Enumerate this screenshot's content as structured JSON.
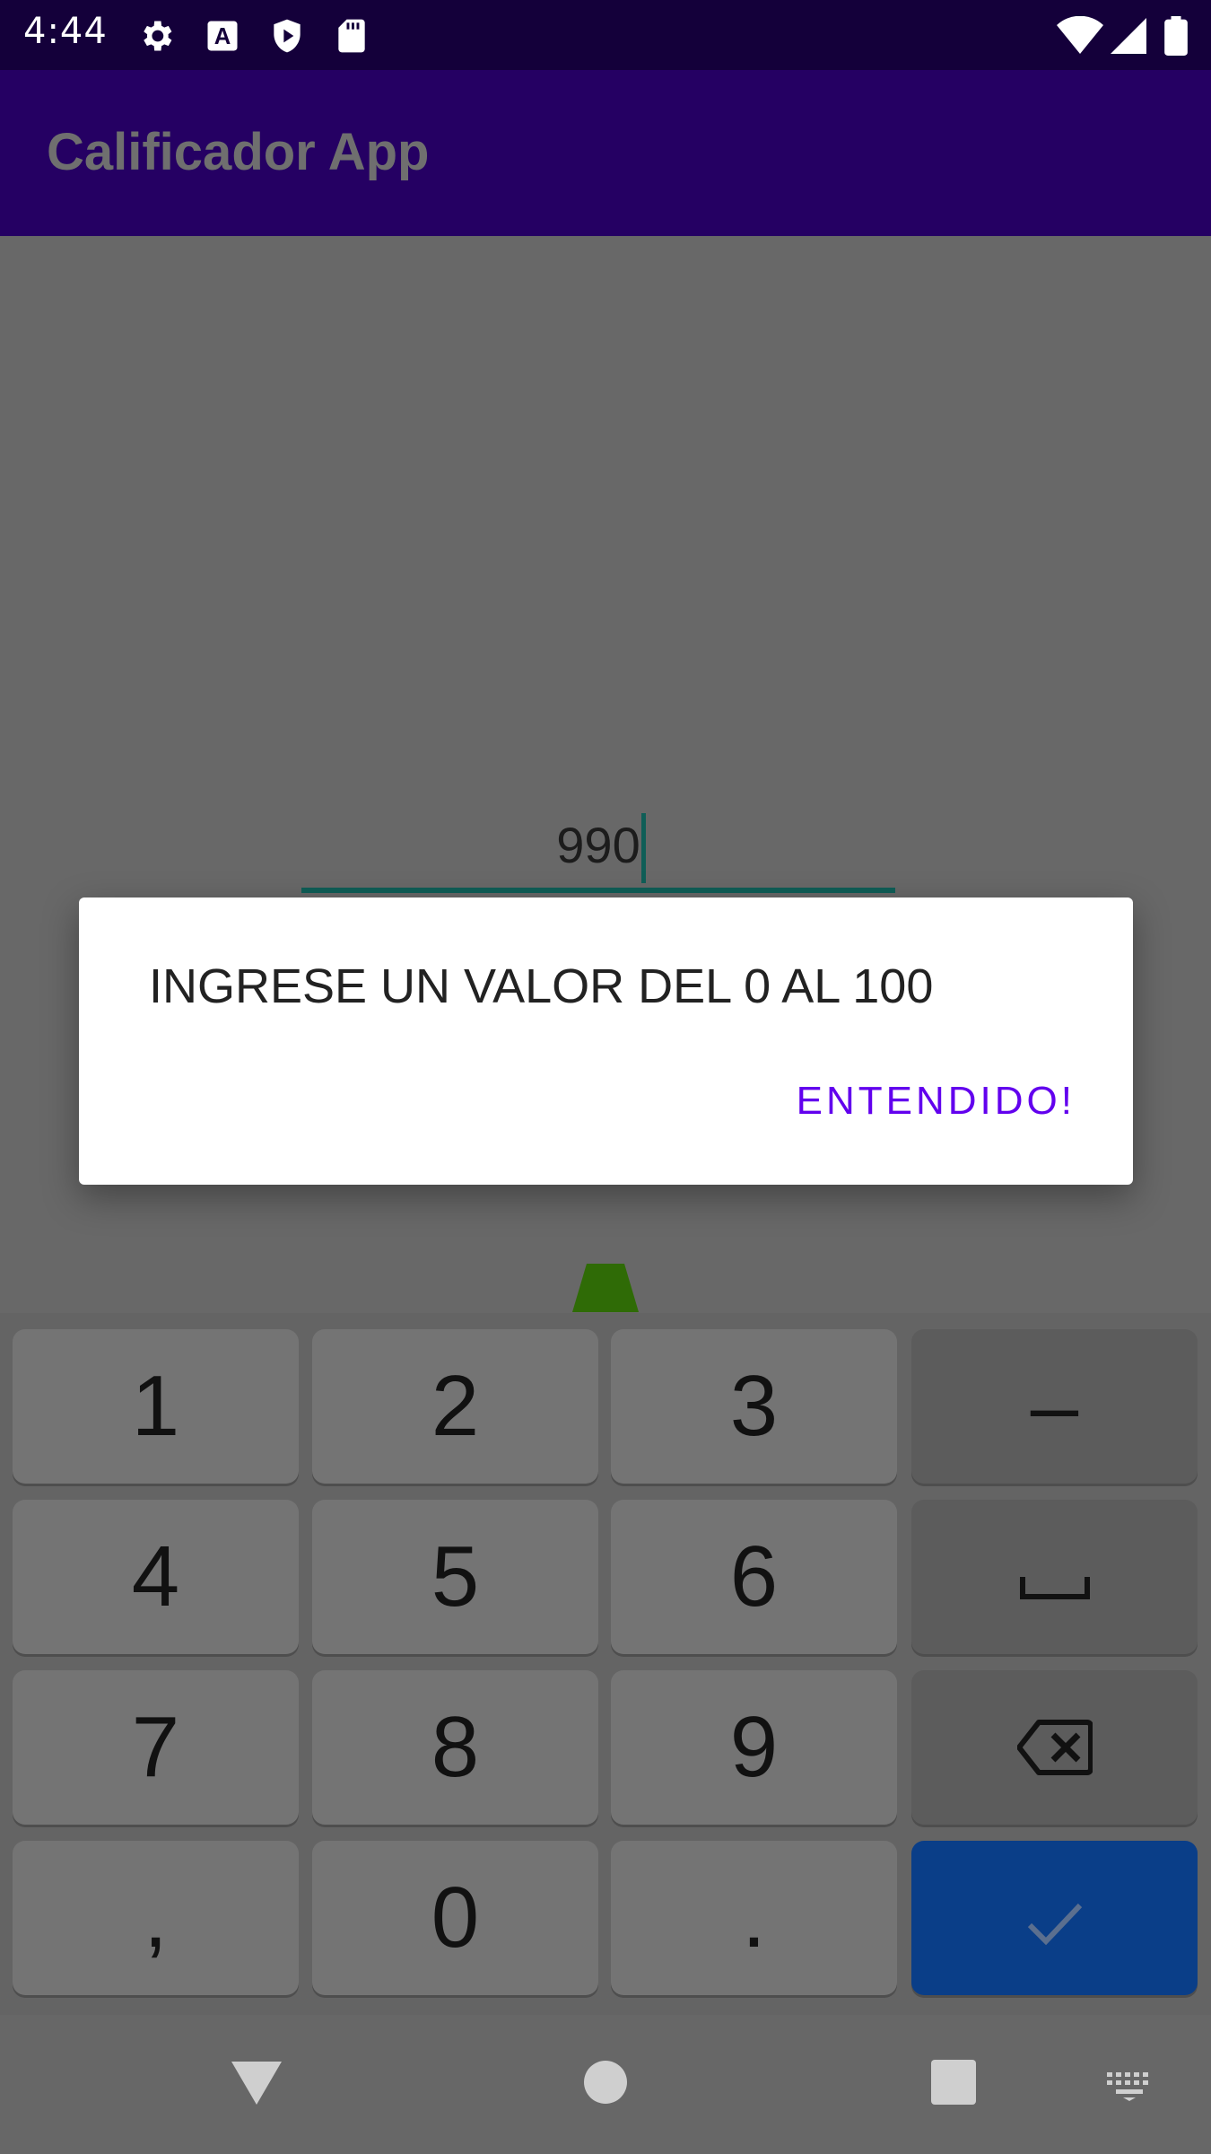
{
  "status_bar": {
    "time": "4:44",
    "icons": [
      "settings-icon",
      "a-icon",
      "shield-play-icon",
      "sd-card-icon",
      "wifi-icon",
      "signal-icon",
      "battery-icon"
    ]
  },
  "app_bar": {
    "title": "Calificador App"
  },
  "input": {
    "value": "990"
  },
  "dialog": {
    "message": "INGRESE UN VALOR DEL 0 AL 100",
    "button_label": "ENTENDIDO!"
  },
  "keyboard": {
    "rows": [
      [
        {
          "label": "1"
        },
        {
          "label": "2"
        },
        {
          "label": "3"
        },
        {
          "label": "–"
        }
      ],
      [
        {
          "label": "4"
        },
        {
          "label": "5"
        },
        {
          "label": "6"
        },
        {
          "label": "␣"
        }
      ],
      [
        {
          "label": "7"
        },
        {
          "label": "8"
        },
        {
          "label": "9"
        },
        {
          "label": ""
        }
      ],
      [
        {
          "label": ","
        },
        {
          "label": "0"
        },
        {
          "label": "."
        },
        {
          "label": ""
        }
      ]
    ]
  },
  "nav": {
    "icons": [
      "back-icon",
      "home-icon",
      "recents-icon",
      "keyboard-switch-icon"
    ]
  },
  "colors": {
    "status_bar": "#14003a",
    "app_bar": "#250063",
    "accent": "#6200ee",
    "input_line": "#0f5e57",
    "enter_key": "#0a3e88"
  }
}
